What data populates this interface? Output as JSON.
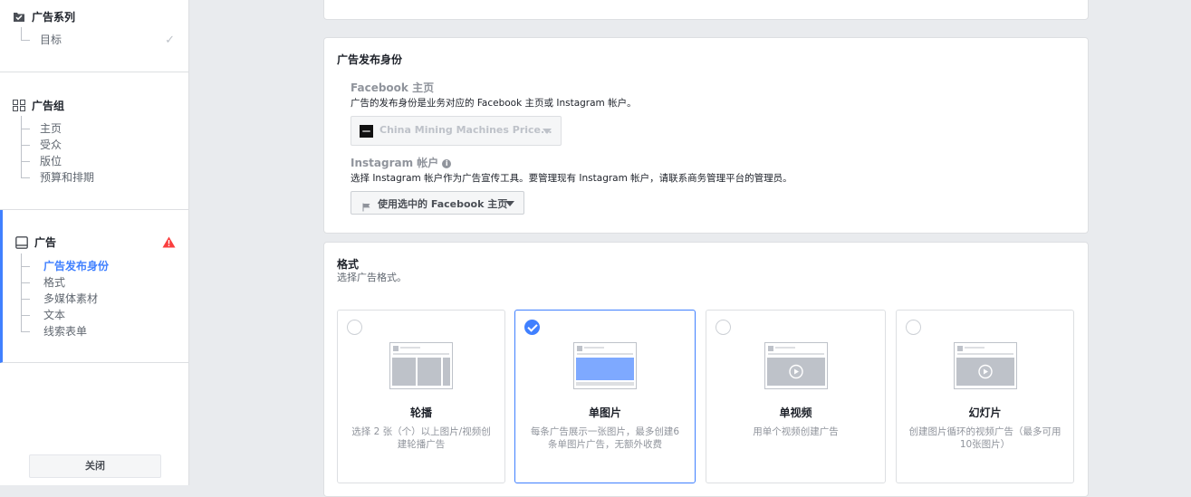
{
  "sidebar": {
    "campaign": {
      "title": "广告系列",
      "items": [
        {
          "label": "目标"
        }
      ]
    },
    "adset": {
      "title": "广告组",
      "items": [
        {
          "label": "主页"
        },
        {
          "label": "受众"
        },
        {
          "label": "版位"
        },
        {
          "label": "预算和排期"
        }
      ]
    },
    "ad": {
      "title": "广告",
      "items": [
        {
          "label": "广告发布身份"
        },
        {
          "label": "格式"
        },
        {
          "label": "多媒体素材"
        },
        {
          "label": "文本"
        },
        {
          "label": "线索表单"
        }
      ]
    },
    "close_label": "关闭"
  },
  "identity": {
    "title": "广告发布身份",
    "facebook": {
      "heading": "Facebook 主页",
      "description": "广告的发布身份是业务对应的 Facebook 主页或 Instagram 帐户。",
      "page_value": "China Mining Machines Price..."
    },
    "instagram": {
      "heading": "Instagram 帐户",
      "description": "选择 Instagram 帐户作为广告宣传工具。要管理现有 Instagram 帐户，请联系商务管理平台的管理员。",
      "select_value": "使用选中的 Facebook 主页"
    }
  },
  "format": {
    "title": "格式",
    "subtitle": "选择广告格式。",
    "options": [
      {
        "name": "轮播",
        "description": "选择 2 张（个）以上图片/视频创建轮播广告",
        "selected": false
      },
      {
        "name": "单图片",
        "description": "每条广告展示一张图片，最多创建6条单图片广告，无额外收费",
        "selected": true
      },
      {
        "name": "单视频",
        "description": "用单个视频创建广告",
        "selected": false
      },
      {
        "name": "幻灯片",
        "description": "创建图片循环的视频广告（最多可用10张图片）",
        "selected": false
      }
    ]
  },
  "colors": {
    "accent": "#4080ff",
    "warning": "#fa3e3e",
    "border": "#dddfe2"
  }
}
